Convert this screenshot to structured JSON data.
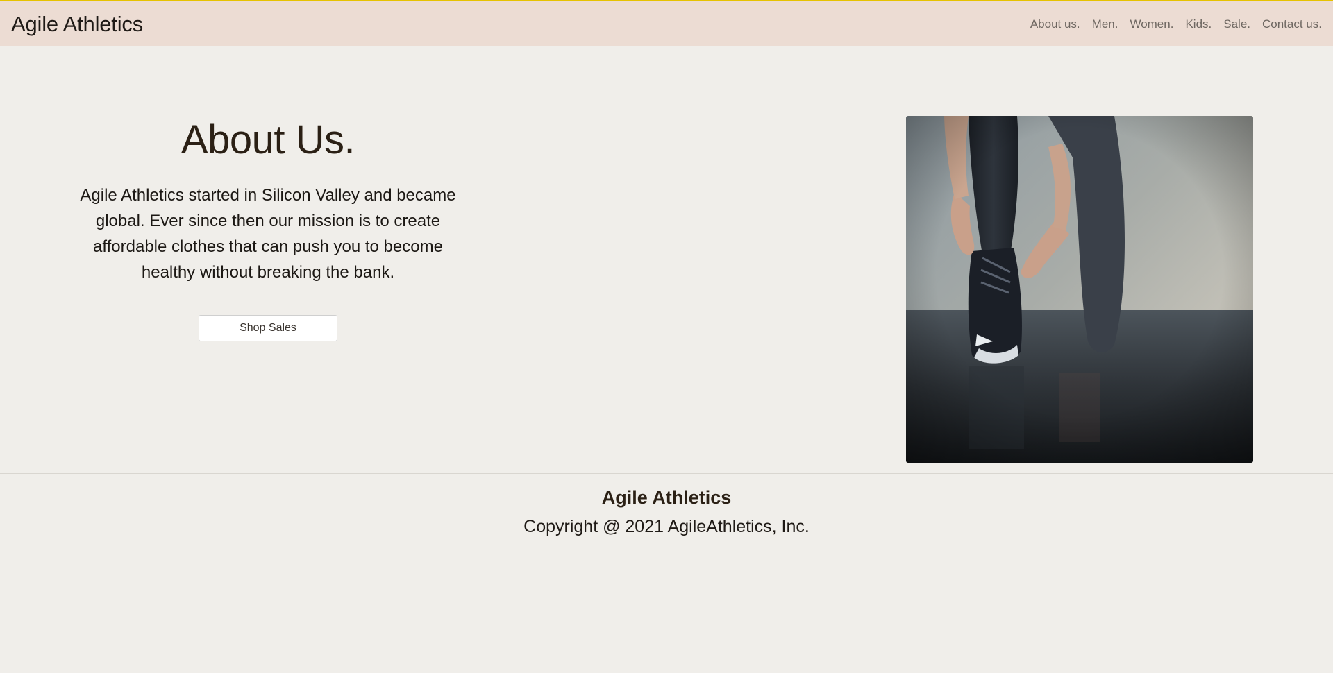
{
  "header": {
    "brand": "Agile Athletics",
    "nav": [
      "About us.",
      "Men.",
      "Women.",
      "Kids.",
      "Sale.",
      "Contact us."
    ]
  },
  "about": {
    "title": "About Us.",
    "body": "Agile Athletics started in Silicon Valley and became global. Ever since then our mission is to create affordable clothes that can push you to become healthy without breaking the bank.",
    "button": "Shop Sales"
  },
  "footer": {
    "brand": "Agile Athletics",
    "copyright": "Copyright @ 2021 AgileAthletics, Inc."
  },
  "colors": {
    "background": "#f0eeea",
    "header_bg": "#ecdcd3",
    "accent_line": "#e6c200"
  }
}
